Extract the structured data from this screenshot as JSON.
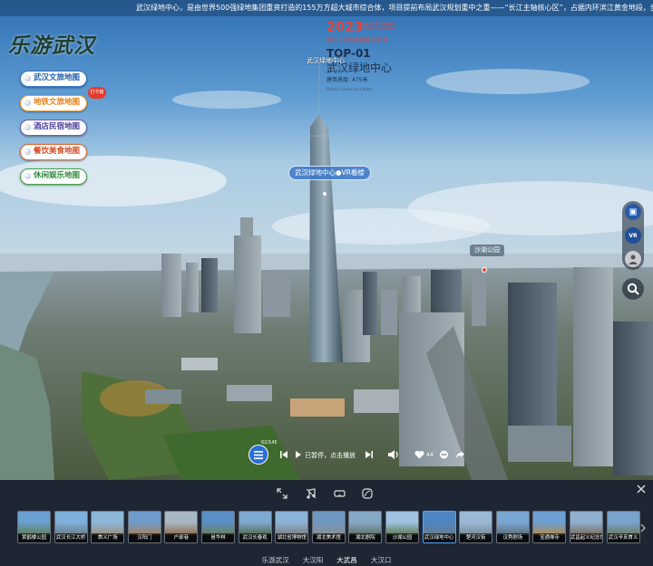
{
  "marquee": {
    "text": "武汉绿地中心，是由世界500强绿地集团重资打造的155万方超大城市综合体，项目提前布局武汉规划重中之重——“长江主轴核心区”，占据内环滨江黄金地段，坐拥“两桥两轨四隧道”"
  },
  "logo": {
    "text": "乐游武汉"
  },
  "menu": {
    "items": [
      {
        "label": "武汉文旅地图"
      },
      {
        "label": "地铁文旅地图"
      },
      {
        "label": "酒店民宿地图"
      },
      {
        "label": "餐饮美食地图"
      },
      {
        "label": "休闲娱乐地图"
      }
    ],
    "badge": "打卡篇"
  },
  "poster": {
    "year": "2023",
    "small": "WUHAN TOP TOWER BUILDING RANKINGS",
    "subline": "武汉十大高层建筑 排行榜",
    "top": "TOP-01",
    "name": "武汉绿地中心",
    "height": "建筑高度: 475米",
    "tiny": "Wuhan Greenland Center"
  },
  "hotspots": {
    "tower_label": "武汉绿地中心",
    "vr_tag": "武汉绿地中心●VR看楼",
    "park_tag": "沙湖公园"
  },
  "tools": {
    "vr": "VR"
  },
  "player": {
    "counter": "62/145",
    "status": "已暂停，点击播放",
    "likes": "44"
  },
  "thumbnails": [
    {
      "label": "黄鹤楼公园"
    },
    {
      "label": "武汉长江大桥"
    },
    {
      "label": "首义广场"
    },
    {
      "label": "汉阳门"
    },
    {
      "label": "户部巷"
    },
    {
      "label": "昙华林"
    },
    {
      "label": "武汉长春观"
    },
    {
      "label": "湖北省博物馆"
    },
    {
      "label": "湖北美术馆"
    },
    {
      "label": "湖北剧院"
    },
    {
      "label": "沙湖公园"
    },
    {
      "label": "武汉绿地中心"
    },
    {
      "label": "楚河汉街"
    },
    {
      "label": "汉秀剧场"
    },
    {
      "label": "宝通禅寺"
    },
    {
      "label": "武昌起义纪念馆"
    },
    {
      "label": "武汉辛亥首义"
    }
  ],
  "tabs": [
    {
      "label": "乐游武汉"
    },
    {
      "label": "大汉阳"
    },
    {
      "label": "大武昌"
    },
    {
      "label": "大汉口"
    }
  ]
}
